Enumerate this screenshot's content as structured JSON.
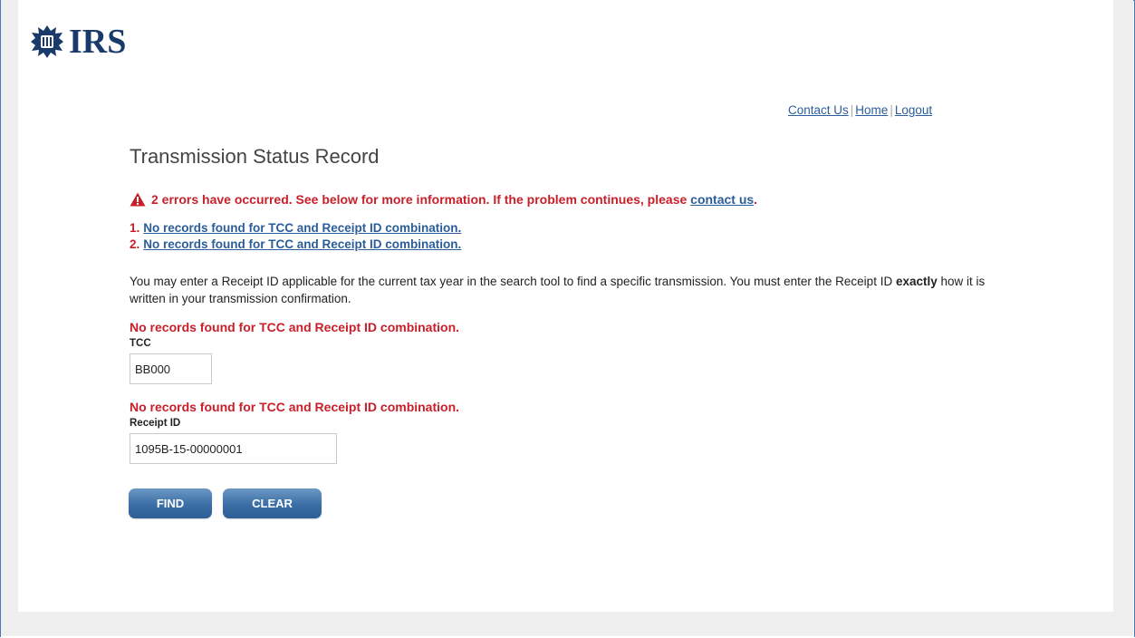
{
  "logo": {
    "text": "IRS",
    "emblem": "irs-eagle-emblem"
  },
  "header_links": {
    "contact": "Contact Us",
    "home": "Home",
    "logout": "Logout",
    "separator": "|"
  },
  "page": {
    "title": "Transmission Status Record"
  },
  "error_summary": {
    "text": "2 errors have occurred. See below for more information. If the problem continues, please",
    "link": "contact us",
    "trailing": ".",
    "icon": "warning-triangle-icon",
    "items": [
      {
        "number": "1.",
        "text": "No records found for TCC and Receipt ID combination."
      },
      {
        "number": "2.",
        "text": "No records found for TCC and Receipt ID combination."
      }
    ]
  },
  "instructions": {
    "before": "You may enter a Receipt ID applicable for the current tax year in the search tool to find a specific transmission. You must enter the Receipt ID ",
    "bold": "exactly",
    "after": " how it is written in your transmission confirmation."
  },
  "tcc": {
    "error": "No records found for TCC and Receipt ID combination.",
    "label": "TCC",
    "value": "BB000"
  },
  "receipt": {
    "error": "No records found for TCC and Receipt ID combination.",
    "label": "Receipt ID",
    "value": "1095B-15-00000001"
  },
  "buttons": {
    "find": "FIND",
    "clear": "CLEAR"
  },
  "colors": {
    "error": "#c8202a",
    "link": "#2a5d9a",
    "button": "#3a6ea6",
    "frame": "#4a78b8",
    "logo": "#1a3a6b"
  }
}
